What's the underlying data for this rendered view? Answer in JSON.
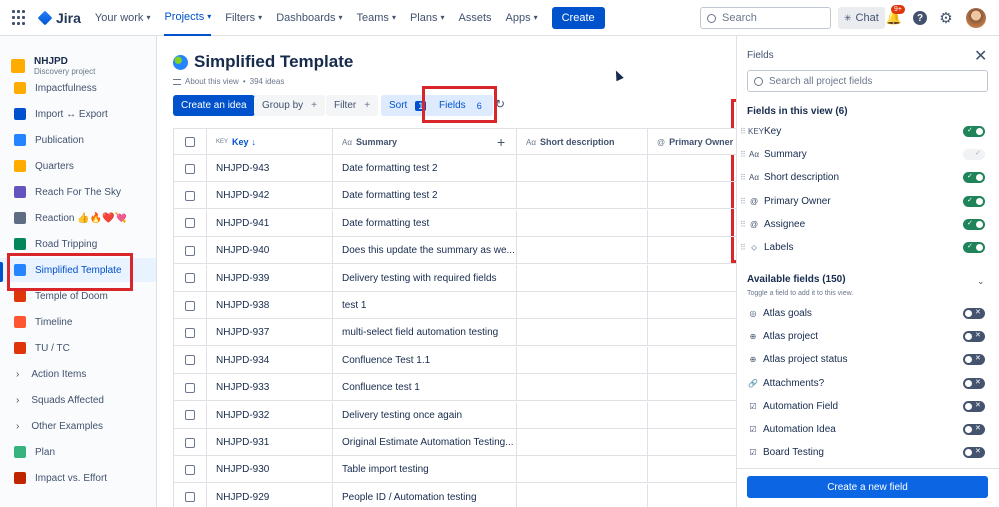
{
  "topnav": {
    "product": "Jira",
    "items": [
      {
        "label": "Your work",
        "chev": "▾",
        "active": false
      },
      {
        "label": "Projects",
        "chev": "▾",
        "active": true
      },
      {
        "label": "Filters",
        "chev": "▾",
        "active": false
      },
      {
        "label": "Dashboards",
        "chev": "▾",
        "active": false
      },
      {
        "label": "Teams",
        "chev": "▾",
        "active": false
      },
      {
        "label": "Plans",
        "chev": "▾",
        "active": false
      },
      {
        "label": "Assets",
        "chev": "",
        "active": false
      },
      {
        "label": "Apps",
        "chev": "▾",
        "active": false
      }
    ],
    "create_label": "Create",
    "search_placeholder": "Search",
    "chat_label": "Chat",
    "notifications_badge": "9+"
  },
  "sidebar": {
    "project_name": "NHJPD",
    "project_type": "Discovery project",
    "items": [
      {
        "label": "Impactfulness",
        "icon_color": "#FFAB00",
        "type": "view"
      },
      {
        "label": "Import ↔ Export",
        "icon_color": "#0052CC",
        "type": "view"
      },
      {
        "label": "Publication",
        "icon_color": "#2684FF",
        "type": "view"
      },
      {
        "label": "Quarters",
        "icon_color": "#FFAB00",
        "type": "view"
      },
      {
        "label": "Reach For The Sky",
        "icon_color": "#6554C0",
        "type": "view"
      },
      {
        "label": "Reaction 👍🔥❤️💘",
        "icon_color": "#5E6C84",
        "type": "view"
      },
      {
        "label": "Road Tripping",
        "icon_color": "#00875A",
        "type": "view"
      },
      {
        "label": "Simplified Template",
        "icon_color": "#2684FF",
        "type": "view",
        "active": true
      },
      {
        "label": "Temple of Doom",
        "icon_color": "#DE350B",
        "type": "view"
      },
      {
        "label": "Timeline",
        "icon_color": "#FF5630",
        "type": "view"
      },
      {
        "label": "TU / TC",
        "icon_color": "#DE350B",
        "type": "view"
      },
      {
        "label": "Action Items",
        "type": "section"
      },
      {
        "label": "Squads Affected",
        "type": "section"
      },
      {
        "label": "Other Examples",
        "type": "section"
      },
      {
        "label": "Plan",
        "icon_color": "#36B37E",
        "type": "view"
      },
      {
        "label": "Impact vs. Effort",
        "icon_color": "#BF2600",
        "type": "view"
      }
    ]
  },
  "view": {
    "title": "Simplified Template",
    "about": "About this view",
    "ideas_count": "394 ideas",
    "separator": "•"
  },
  "toolbar": {
    "create_idea": "Create an idea",
    "group_by": "Group by",
    "filter": "Filter",
    "sort": "Sort",
    "sort_count": "1",
    "fields": "Fields",
    "fields_count": "6",
    "plus": "+"
  },
  "table": {
    "columns": [
      {
        "label": "Key",
        "icon": "KEY",
        "sort": "↓"
      },
      {
        "label": "Summary",
        "icon": "Aα"
      },
      {
        "label": "Short description",
        "icon": "Aα"
      },
      {
        "label": "Primary Owner",
        "icon": "@"
      }
    ],
    "add_column": "+",
    "rows": [
      {
        "key": "NHJPD-943",
        "summary": "Date formatting test 2"
      },
      {
        "key": "NHJPD-942",
        "summary": "Date formatting test 2"
      },
      {
        "key": "NHJPD-941",
        "summary": "Date formatting test"
      },
      {
        "key": "NHJPD-940",
        "summary": "Does this update the summary as we..."
      },
      {
        "key": "NHJPD-939",
        "summary": "Delivery testing with required fields"
      },
      {
        "key": "NHJPD-938",
        "summary": "test 1"
      },
      {
        "key": "NHJPD-937",
        "summary": "multi-select field automation testing"
      },
      {
        "key": "NHJPD-934",
        "summary": "Confluence Test 1.1"
      },
      {
        "key": "NHJPD-933",
        "summary": "Confluence test 1"
      },
      {
        "key": "NHJPD-932",
        "summary": "Delivery testing once again"
      },
      {
        "key": "NHJPD-931",
        "summary": "Original Estimate Automation Testing..."
      },
      {
        "key": "NHJPD-930",
        "summary": "Table import testing"
      },
      {
        "key": "NHJPD-929",
        "summary": "People ID / Automation testing"
      }
    ]
  },
  "fields_panel": {
    "title": "Fields",
    "search_placeholder": "Search all project fields",
    "in_view_title": "Fields in this view (6)",
    "in_view": [
      {
        "label": "Key",
        "icon": "KEY",
        "state": "on"
      },
      {
        "label": "Summary",
        "icon": "Aα",
        "state": "disabled"
      },
      {
        "label": "Short description",
        "icon": "Aα",
        "state": "on"
      },
      {
        "label": "Primary Owner",
        "icon": "@",
        "state": "on"
      },
      {
        "label": "Assignee",
        "icon": "@",
        "state": "on"
      },
      {
        "label": "Labels",
        "icon": "⬦",
        "state": "on"
      }
    ],
    "available_title": "Available fields (150)",
    "available_sub": "Toggle a field to add it to this view.",
    "available": [
      {
        "label": "Atlas goals",
        "icon": "◎",
        "state": "off"
      },
      {
        "label": "Atlas project",
        "icon": "⊕",
        "state": "off"
      },
      {
        "label": "Atlas project status",
        "icon": "⊕",
        "state": "off"
      },
      {
        "label": "Attachments?",
        "icon": "🔗",
        "state": "off"
      },
      {
        "label": "Automation Field",
        "icon": "☑",
        "state": "off"
      },
      {
        "label": "Automation Idea",
        "icon": "☑",
        "state": "off"
      },
      {
        "label": "Board Testing",
        "icon": "☑",
        "state": "off"
      }
    ],
    "create_new_field": "Create a new field"
  }
}
